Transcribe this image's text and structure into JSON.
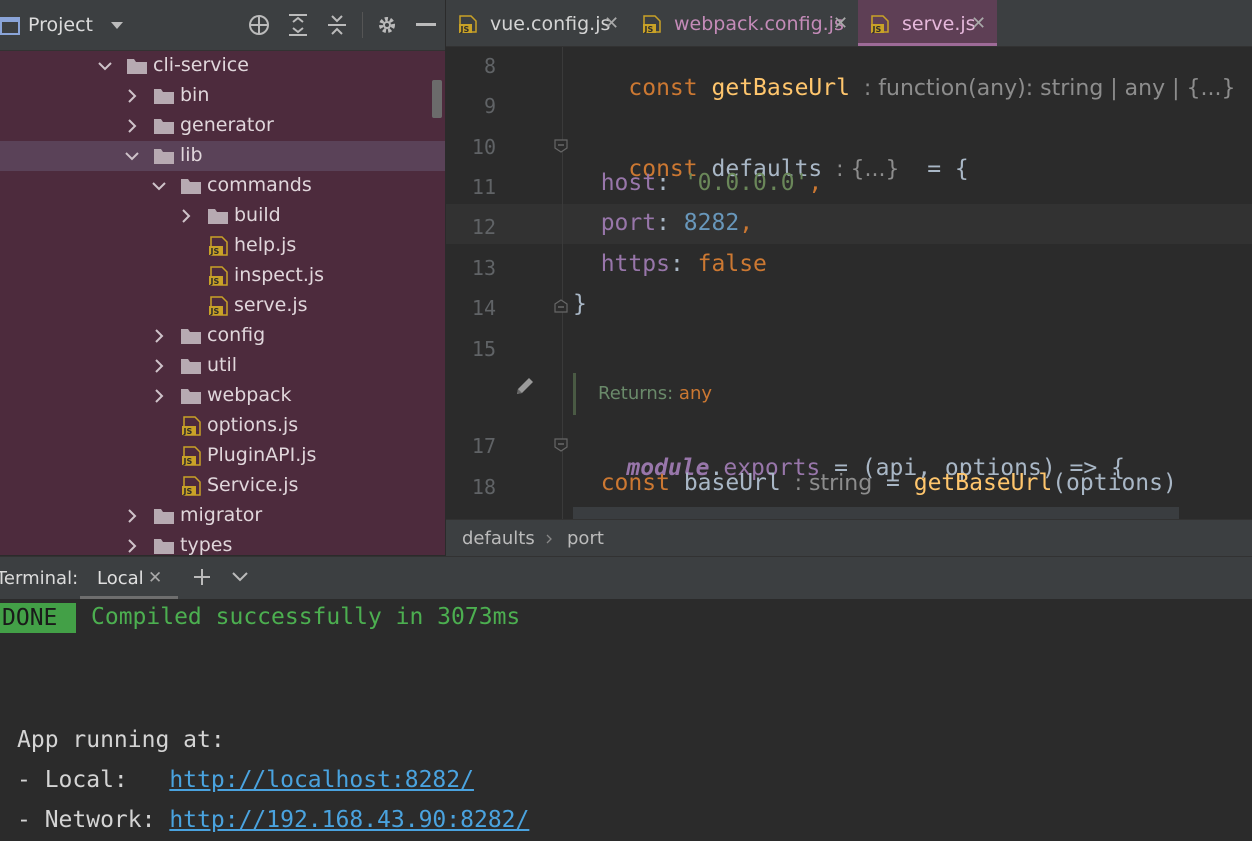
{
  "project": {
    "title": "Project",
    "tree": [
      {
        "label": "cli-service",
        "type": "folder",
        "depth": 0,
        "expanded": true
      },
      {
        "label": "bin",
        "type": "folder",
        "depth": 1,
        "expanded": false
      },
      {
        "label": "generator",
        "type": "folder",
        "depth": 1,
        "expanded": false
      },
      {
        "label": "lib",
        "type": "folder",
        "depth": 1,
        "expanded": true,
        "selected": true
      },
      {
        "label": "commands",
        "type": "folder",
        "depth": 2,
        "expanded": true
      },
      {
        "label": "build",
        "type": "folder",
        "depth": 3,
        "expanded": false
      },
      {
        "label": "help.js",
        "type": "js",
        "depth": 3
      },
      {
        "label": "inspect.js",
        "type": "js",
        "depth": 3
      },
      {
        "label": "serve.js",
        "type": "js",
        "depth": 3
      },
      {
        "label": "config",
        "type": "folder",
        "depth": 2,
        "expanded": false
      },
      {
        "label": "util",
        "type": "folder",
        "depth": 2,
        "expanded": false
      },
      {
        "label": "webpack",
        "type": "folder",
        "depth": 2,
        "expanded": false
      },
      {
        "label": "options.js",
        "type": "js",
        "depth": 2
      },
      {
        "label": "PluginAPI.js",
        "type": "js",
        "depth": 2
      },
      {
        "label": "Service.js",
        "type": "js",
        "depth": 2
      },
      {
        "label": "migrator",
        "type": "folder",
        "depth": 1,
        "expanded": false
      },
      {
        "label": "types",
        "type": "folder",
        "depth": 1,
        "expanded": false
      }
    ]
  },
  "tabs": [
    {
      "label": "vue.config.js",
      "active": false
    },
    {
      "label": "webpack.config.js",
      "active": false
    },
    {
      "label": "serve.js",
      "active": true
    }
  ],
  "editor": {
    "line_numbers": [
      "8",
      "9",
      "10",
      "11",
      "12",
      "13",
      "14",
      "15",
      "17",
      "18"
    ],
    "line8": {
      "kw": "const",
      "name": "getBaseUrl",
      "hint": ": function(any): string | any | {...}"
    },
    "line10": {
      "kw": "const",
      "name": "defaults",
      "hint": ": {...}",
      "rest": " = {"
    },
    "line11": {
      "key": "host",
      "value": "'0.0.0.0'"
    },
    "line12": {
      "key": "port",
      "value": "8282"
    },
    "line13": {
      "key": "https",
      "value": "false"
    },
    "line14": {
      "text": "}"
    },
    "returns": {
      "label": "Returns:",
      "value": "any"
    },
    "line17": {
      "module": "module",
      "prop": "exports",
      "rest": " = (api, options) => {"
    },
    "line18": {
      "kw": "const",
      "name": "baseUrl",
      "hint": ": string",
      "eq": " = ",
      "fn": "getBaseUrl",
      "rest": "(options)"
    }
  },
  "breadcrumb": {
    "first": "defaults",
    "second": "port"
  },
  "terminal": {
    "label": "Terminal:",
    "tab": "Local",
    "done": "DONE",
    "compiled": "Compiled successfully in 3073ms",
    "app_running": "App running at:",
    "local_prefix": "- Local:   ",
    "local_url": "http://localhost:8282/",
    "network_prefix": "- Network: ",
    "network_url": "http://192.168.43.90:8282/"
  },
  "colors": {
    "tree_bg": "#4d2b3d",
    "active_tab": "#5e3f55",
    "done_badge": "#43a047",
    "link": "#4aa3df"
  }
}
